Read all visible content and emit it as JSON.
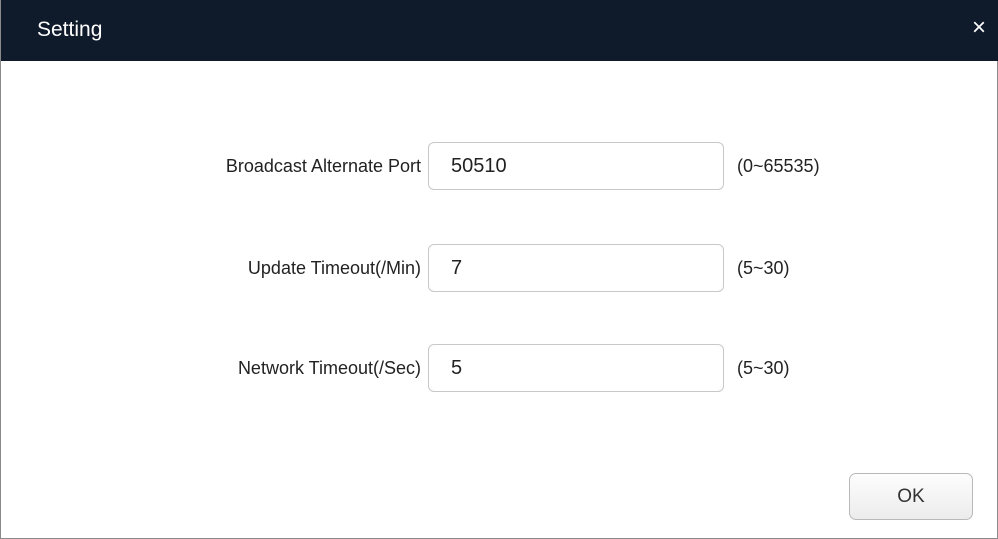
{
  "window": {
    "title": "Setting",
    "close_icon": "close-icon",
    "close_glyph": "×"
  },
  "fields": [
    {
      "label": "Broadcast Alternate Port",
      "value": "50510",
      "range": "(0~65535)"
    },
    {
      "label": "Update Timeout(/Min)",
      "value": "7",
      "range": "(5~30)"
    },
    {
      "label": "Network Timeout(/Sec)",
      "value": "5",
      "range": "(5~30)"
    }
  ],
  "actions": {
    "ok_label": "OK"
  },
  "colors": {
    "titlebar": "#0f1a2a",
    "title_text": "#ffffff",
    "background": "#ffffff",
    "field_border": "#c8c8c8"
  }
}
